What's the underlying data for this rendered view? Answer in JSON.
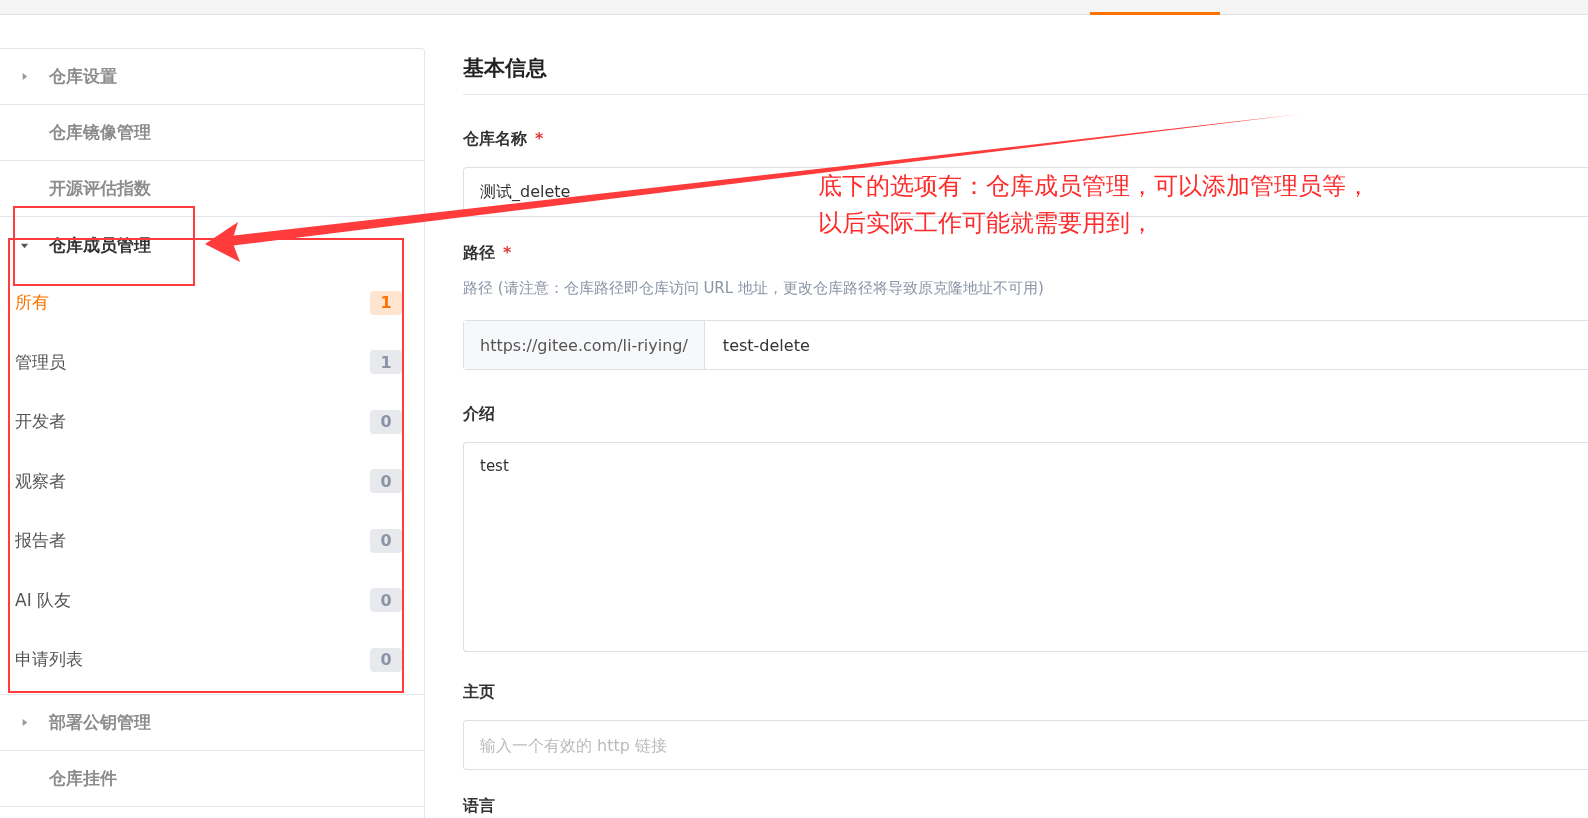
{
  "sidebar": {
    "items": [
      {
        "kind": "collapsible",
        "label": "仓库设置",
        "expanded": false
      },
      {
        "kind": "plain",
        "label": "仓库镜像管理"
      },
      {
        "kind": "plain",
        "label": "开源评估指数"
      },
      {
        "kind": "collapsible",
        "label": "仓库成员管理",
        "expanded": true,
        "children": [
          {
            "label": "所有",
            "count": "1",
            "selected": true
          },
          {
            "label": "管理员",
            "count": "1",
            "selected": false
          },
          {
            "label": "开发者",
            "count": "0",
            "selected": false
          },
          {
            "label": "观察者",
            "count": "0",
            "selected": false
          },
          {
            "label": "报告者",
            "count": "0",
            "selected": false
          },
          {
            "label": "AI 队友",
            "count": "0",
            "selected": false
          },
          {
            "label": "申请列表",
            "count": "0",
            "selected": false
          }
        ]
      },
      {
        "kind": "collapsible",
        "label": "部署公钥管理",
        "expanded": false
      },
      {
        "kind": "plain",
        "label": "仓库挂件"
      }
    ]
  },
  "main": {
    "title": "基本信息",
    "fields": [
      {
        "kind": "input",
        "label": "仓库名称",
        "required_mark": "*",
        "value": "测试_delete"
      },
      {
        "kind": "prefixed",
        "label": "路径",
        "required_mark": "*",
        "hint": "路径 (请注意：仓库路径即仓库访问 URL 地址，更改仓库路径将导致原克隆地址不可用)",
        "prefix": "https://gitee.com/li-riying/",
        "value": "test-delete"
      },
      {
        "kind": "textarea",
        "label": "介绍",
        "value": "test"
      },
      {
        "kind": "input",
        "label": "主页",
        "placeholder": "输入一个有效的 http 链接"
      },
      {
        "kind": "label",
        "label": "语言"
      }
    ]
  },
  "annotation": {
    "lines": [
      "底下的选项有：仓库成员管理，可以添加管理员等，",
      "以后实际工作可能就需要用到，"
    ]
  }
}
